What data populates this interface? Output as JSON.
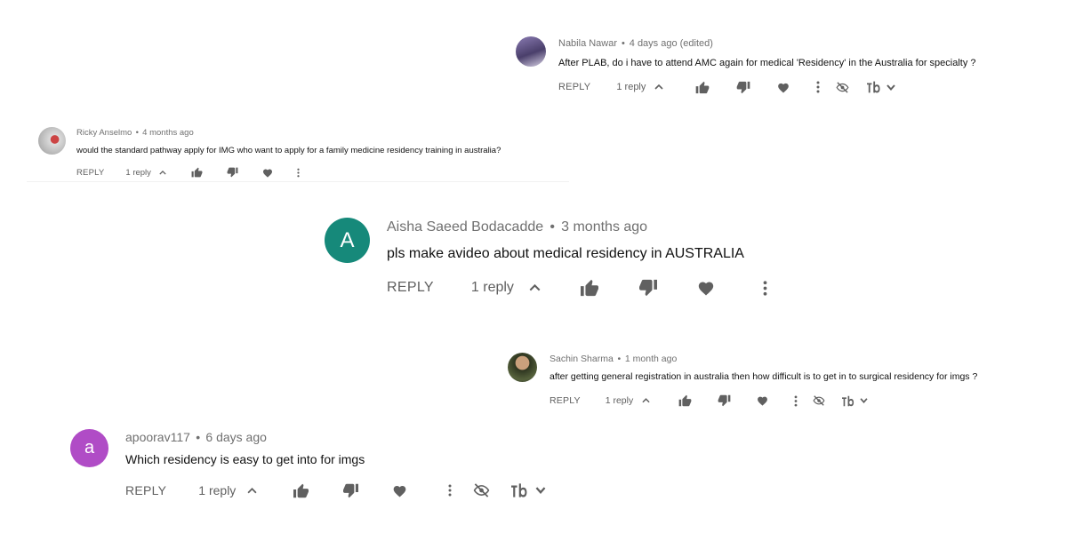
{
  "comments": [
    {
      "author": "Nabila Nawar",
      "time": "4 days ago (edited)",
      "text": "After PLAB, do i have to attend AMC again for medical 'Residency' in the Australia for specialty ?",
      "reply_label": "REPLY",
      "replies": "1 reply",
      "avatar_letter": ""
    },
    {
      "author": "Ricky Anselmo",
      "time": "4 months ago",
      "text": "would the standard pathway apply for IMG who want to apply for a family medicine residency training in australia?",
      "reply_label": "REPLY",
      "replies": "1 reply",
      "avatar_letter": ""
    },
    {
      "author": "Aisha Saeed Bodacadde",
      "time": "3 months ago",
      "text": "pls make avideo about medical residency in AUSTRALIA",
      "reply_label": "REPLY",
      "replies": "1 reply",
      "avatar_letter": "A",
      "avatar_color": "#16897a"
    },
    {
      "author": "Sachin Sharma",
      "time": "1 month ago",
      "text": "after getting general registration in australia then how difficult is to get in to surgical residency for imgs ?",
      "reply_label": "REPLY",
      "replies": "1 reply",
      "avatar_letter": ""
    },
    {
      "author": "apoorav117",
      "time": "6 days ago",
      "text": "Which residency is easy to get into for imgs",
      "reply_label": "REPLY",
      "replies": "1 reply",
      "avatar_letter": "a",
      "avatar_color": "#b04cc6"
    }
  ],
  "separator": "•",
  "icons": {
    "like": "thumbs-up-icon",
    "dislike": "thumbs-down-icon",
    "heart": "heart-icon",
    "more": "more-vert-icon",
    "hide": "eye-off-icon",
    "tb": "tubebuddy-icon",
    "chevron_up": "chevron-up-icon",
    "chevron_down": "chevron-down-icon"
  },
  "colors": {
    "meta_text": "#707070",
    "action_text": "#606060",
    "icon": "#606060"
  }
}
